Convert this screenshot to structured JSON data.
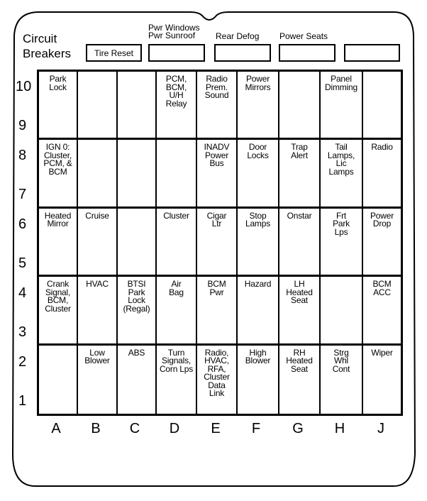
{
  "title": [
    "Circuit",
    "Breakers"
  ],
  "top_labels": {
    "pwr_windows": [
      "Pwr Windows",
      "Pwr Sunroof"
    ],
    "rear_defog": "Rear Defog",
    "power_seats": "Power Seats"
  },
  "top_boxes": {
    "tire_reset": "Tire Reset",
    "pwr_windows": "",
    "rear_defog": "",
    "power_seats": "",
    "unlabeled": ""
  },
  "row_labels": [
    "10",
    "9",
    "8",
    "7",
    "6",
    "5",
    "4",
    "3",
    "2",
    "1"
  ],
  "column_labels": [
    "A",
    "B",
    "C",
    "D",
    "E",
    "F",
    "G",
    "H",
    "J"
  ],
  "grid": [
    [
      "Park\nLock",
      "",
      "",
      "PCM,\nBCM,\nU/H\nRelay",
      "Radio\nPrem.\nSound",
      "Power\nMirrors",
      "",
      "Panel\nDimming",
      ""
    ],
    [
      "IGN 0:\nCluster,\nPCM, &\nBCM",
      "",
      "",
      "",
      "INADV\nPower\nBus",
      "Door\nLocks",
      "Trap\nAlert",
      "Tail\nLamps,\nLic\nLamps",
      "Radio"
    ],
    [
      "Heated\nMirror",
      "Cruise",
      "",
      "Cluster",
      "Cigar\nLtr",
      "Stop\nLamps",
      "Onstar",
      "Frt\nPark\nLps",
      "Power\nDrop"
    ],
    [
      "Crank\nSignal,\nBCM,\nCluster",
      "HVAC",
      "BTSI\nPark\nLock\n(Regal)",
      "Air\nBag",
      "BCM\nPwr",
      "Hazard",
      "LH\nHeated\nSeat",
      "",
      "BCM\nACC"
    ],
    [
      "",
      "Low\nBlower",
      "ABS",
      "Turn\nSignals,\nCorn Lps",
      "Radio,\nHVAC,\nRFA,\nCluster\nData\nLink",
      "High\nBlower",
      "RH\nHeated\nSeat",
      "Strg\nWhl\nCont",
      "Wiper"
    ]
  ]
}
